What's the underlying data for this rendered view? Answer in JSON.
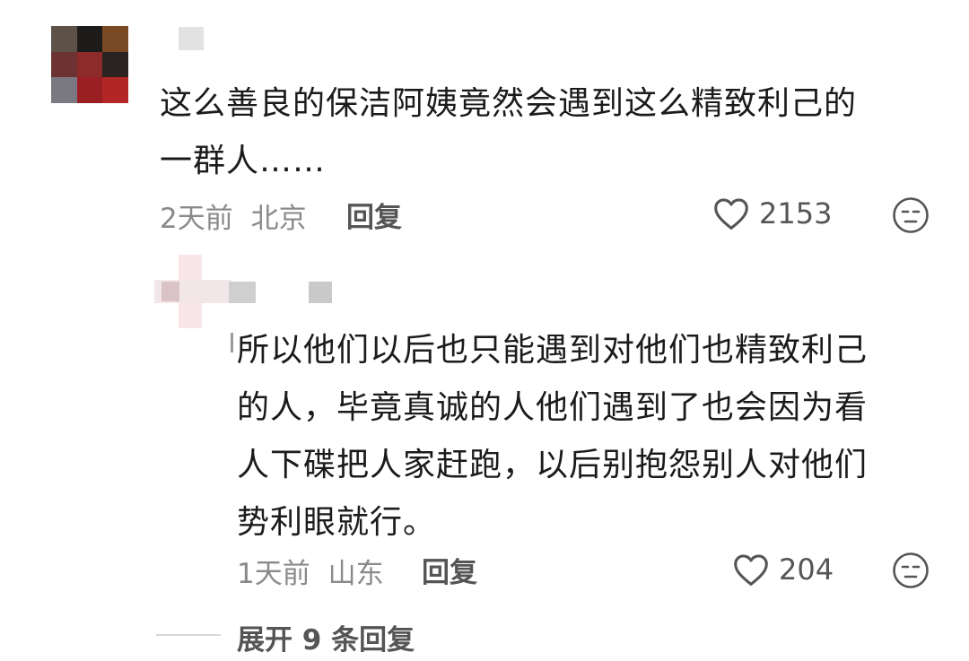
{
  "comment": {
    "text_line1": "这么善良的保洁阿姨竟然会遇到这么精致利己的",
    "text_line2": "一群人……",
    "time": "2天前",
    "location": "北京",
    "reply_label": "回复",
    "likes": "2153"
  },
  "reply": {
    "text_lines": [
      "所以他们以后也只能遇到对他们也精致利己",
      "的人，毕竟真诚的人他们遇到了也会因为看",
      "人下碟把人家赶跑，以后别抱怨别人对他们",
      "势利眼就行。"
    ],
    "time": "1天前",
    "location": "山东",
    "reply_label": "回复",
    "likes": "204"
  },
  "expand_replies_label": "展开 9 条回复",
  "icons": {
    "like": "heart-outline-icon",
    "dislike": "unamused-face-icon"
  },
  "colors": {
    "text": "#1b1b1b",
    "meta": "#8a8a8a",
    "action": "#555555"
  }
}
